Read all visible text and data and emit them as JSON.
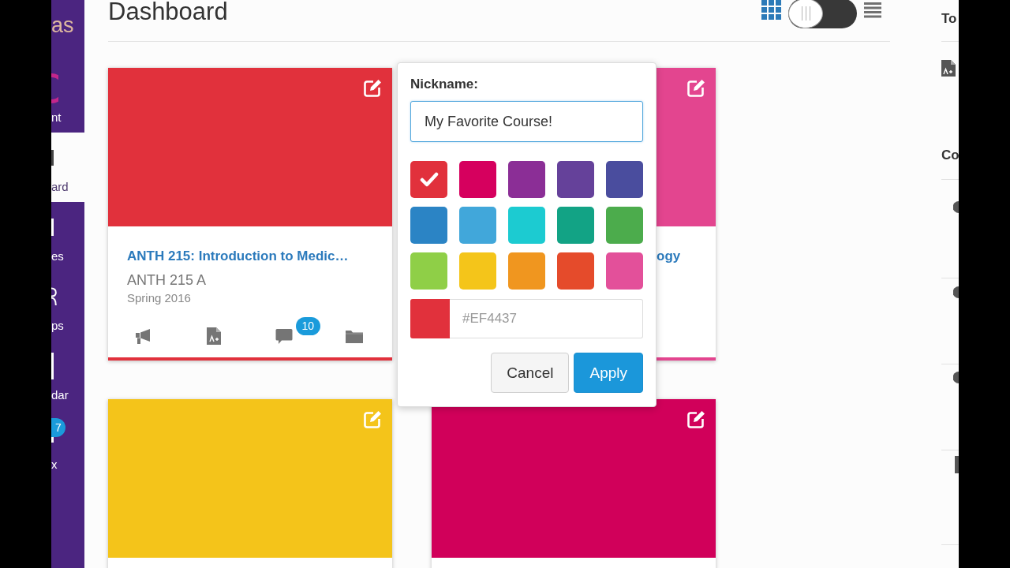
{
  "sidebar": {
    "logo_text": "as",
    "items": [
      {
        "label": "nt",
        "selected": false
      },
      {
        "label": "ard",
        "selected": true
      },
      {
        "label": "es",
        "selected": false
      },
      {
        "label": "ps",
        "selected": false
      },
      {
        "label": "dar",
        "selected": false
      },
      {
        "label": "x",
        "selected": false,
        "badge": "7"
      }
    ]
  },
  "page": {
    "title": "Dashboard",
    "view_options": [
      {
        "kind": "grid",
        "selected": true
      },
      {
        "kind": "list",
        "selected": false
      }
    ]
  },
  "cards": [
    {
      "color": "#e1313c",
      "title": "ANTH 215: Introduction to Medic…",
      "code": "ANTH 215 A",
      "term": "Spring 2016",
      "actions": [
        {
          "kind": "announcements"
        },
        {
          "kind": "grades"
        },
        {
          "kind": "discussions",
          "badge": "10"
        },
        {
          "kind": "files"
        }
      ]
    },
    {
      "color": "#e3458f",
      "title": "ogy"
    },
    {
      "color": "#f4c41a"
    },
    {
      "color": "#d1005a"
    }
  ],
  "nickname_popover": {
    "label": "Nickname:",
    "value": "My Favorite Course!",
    "swatches": [
      {
        "color": "#e1313c",
        "selected": true
      },
      {
        "color": "#d6005e",
        "selected": false
      },
      {
        "color": "#8b2e96",
        "selected": false
      },
      {
        "color": "#65419a",
        "selected": false
      },
      {
        "color": "#4a4d9e",
        "selected": false
      },
      {
        "color": "#2b84c5",
        "selected": false
      },
      {
        "color": "#41a7da",
        "selected": false
      },
      {
        "color": "#1ccbd1",
        "selected": false
      },
      {
        "color": "#12a385",
        "selected": false
      },
      {
        "color": "#4cac4c",
        "selected": false
      },
      {
        "color": "#8fcf47",
        "selected": false
      },
      {
        "color": "#f4c51a",
        "selected": false
      },
      {
        "color": "#f0961f",
        "selected": false
      },
      {
        "color": "#e54b2b",
        "selected": false
      },
      {
        "color": "#e3509a",
        "selected": false
      }
    ],
    "hex_field": {
      "placeholder": "#EF4437"
    },
    "buttons": [
      {
        "label": "Cancel",
        "kind": "secondary"
      },
      {
        "label": "Apply",
        "kind": "primary"
      }
    ]
  },
  "right_sidebar": {
    "heading": "To",
    "section_heading": "Co"
  }
}
